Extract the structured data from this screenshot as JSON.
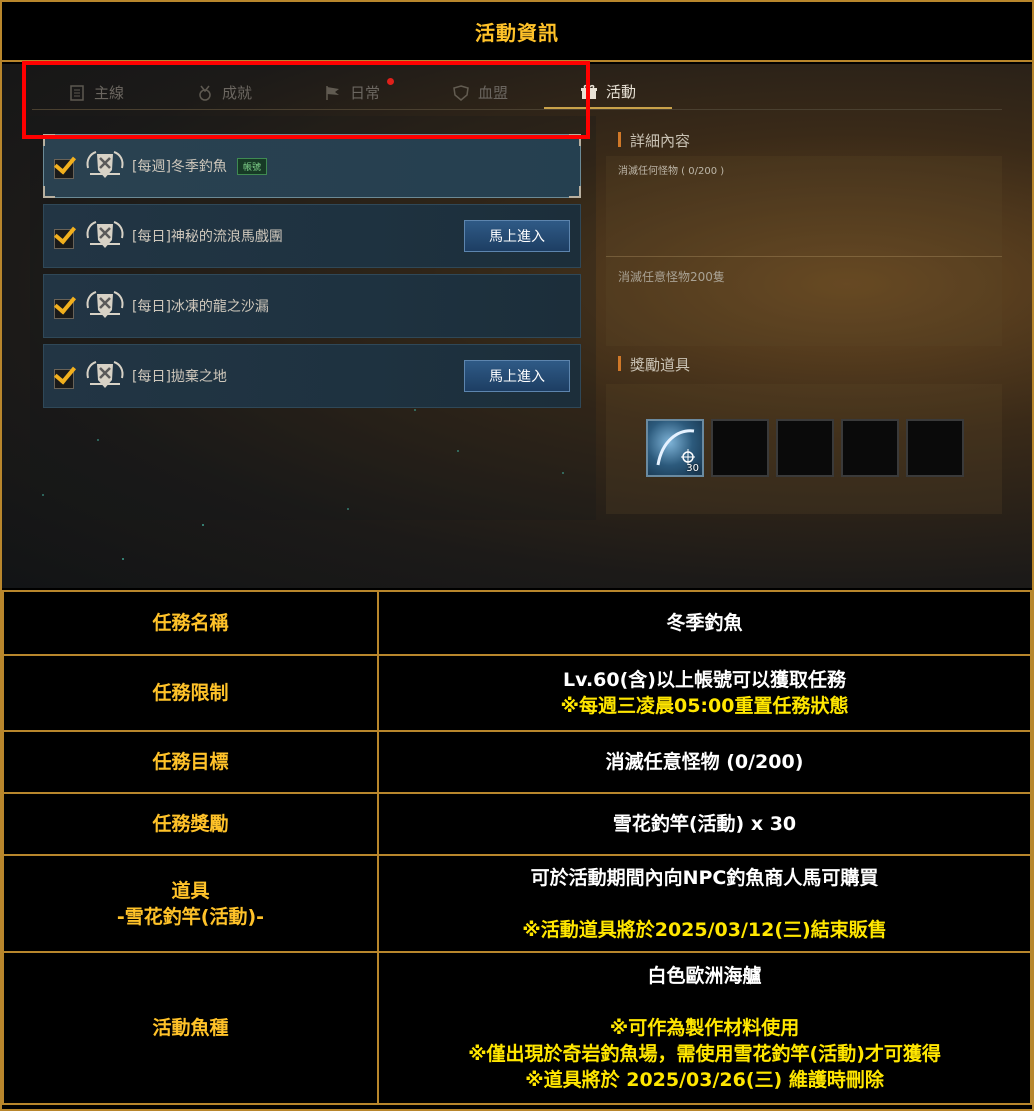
{
  "header": {
    "title": "活動資訊"
  },
  "game": {
    "tabs": [
      {
        "label": "主線",
        "icon": "scroll-icon",
        "active": false,
        "notify": false
      },
      {
        "label": "成就",
        "icon": "medal-icon",
        "active": false,
        "notify": false
      },
      {
        "label": "日常",
        "icon": "flag-icon",
        "active": false,
        "notify": true
      },
      {
        "label": "血盟",
        "icon": "shield-icon",
        "active": false,
        "notify": false
      },
      {
        "label": "活動",
        "icon": "gift-icon",
        "active": true,
        "notify": false
      }
    ],
    "quests": [
      {
        "name": "[每週]冬季釣魚",
        "tag": "帳號",
        "button": "",
        "selected": true
      },
      {
        "name": "[每日]神秘的流浪馬戲團",
        "tag": "",
        "button": "馬上進入",
        "selected": false
      },
      {
        "name": "[每日]冰凍的龍之沙漏",
        "tag": "",
        "button": "",
        "selected": false
      },
      {
        "name": "[每日]拋棄之地",
        "tag": "",
        "button": "馬上進入",
        "selected": false
      }
    ],
    "detail": {
      "title": "詳細內容",
      "progress": "消滅任何怪物 ( 0/200 )",
      "description": "消滅任意怪物200隻"
    },
    "rewards": {
      "title": "獎勵道具",
      "slots": [
        {
          "item": "snowflake-fishing-rod-icon",
          "qty": "30"
        },
        {
          "item": "",
          "qty": ""
        },
        {
          "item": "",
          "qty": ""
        },
        {
          "item": "",
          "qty": ""
        },
        {
          "item": "",
          "qty": ""
        }
      ]
    }
  },
  "table": {
    "rows": [
      {
        "key": "任務名稱",
        "lines": [
          {
            "text": "冬季釣魚",
            "color": "white"
          }
        ]
      },
      {
        "key": "任務限制",
        "lines": [
          {
            "text": "Lv.60(含)以上帳號可以獲取任務",
            "color": "white"
          },
          {
            "text": "※每週三凌晨05:00重置任務狀態",
            "color": "yellow"
          }
        ]
      },
      {
        "key": "任務目標",
        "lines": [
          {
            "text": "消滅任意怪物 (0/200)",
            "color": "white"
          }
        ]
      },
      {
        "key": "任務獎勵",
        "lines": [
          {
            "text": "雪花釣竿(活動) x 30",
            "color": "white"
          }
        ]
      },
      {
        "key": "道具",
        "key2": "-雪花釣竿(活動)-",
        "lines": [
          {
            "text": "可於活動期間內向NPC釣魚商人馬可購買",
            "color": "white"
          },
          {
            "text": "",
            "color": "white"
          },
          {
            "text": "※活動道具將於2025/03/12(三)結束販售",
            "color": "yellow"
          }
        ]
      },
      {
        "key": "活動魚種",
        "lines": [
          {
            "text": "白色歐洲海艫",
            "color": "white"
          },
          {
            "text": "",
            "color": "white"
          },
          {
            "text": "※可作為製作材料使用",
            "color": "yellow"
          },
          {
            "text": "※僅出現於奇岩釣魚場，需使用雪花釣竿(活動)才可獲得",
            "color": "yellow"
          },
          {
            "text": "※道具將於 2025/03/26(三) 維護時刪除",
            "color": "yellow"
          }
        ]
      }
    ]
  },
  "colors": {
    "border": "#b8862c",
    "key_text": "#ffc229",
    "note_text": "#ffe600",
    "highlight": "#ff0000"
  }
}
